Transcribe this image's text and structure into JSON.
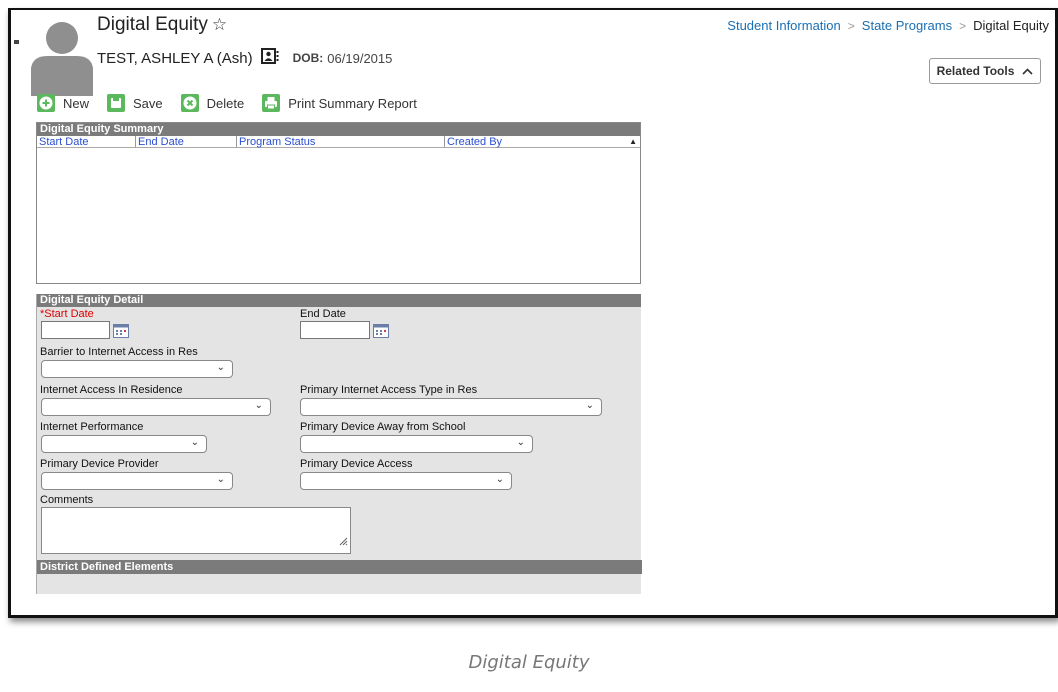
{
  "header": {
    "title": "Digital Equity",
    "student_name": "TEST, ASHLEY A (Ash)",
    "dob_label": "DOB:",
    "dob_value": "06/19/2015",
    "related_tools_label": "Related Tools"
  },
  "breadcrumb": {
    "items": [
      "Student Information",
      "State Programs"
    ],
    "current": "Digital Equity"
  },
  "toolbar": {
    "new_label": "New",
    "save_label": "Save",
    "delete_label": "Delete",
    "print_label": "Print Summary Report"
  },
  "summary": {
    "title": "Digital Equity Summary",
    "columns": [
      "Start Date",
      "End Date",
      "Program Status",
      "Created By"
    ],
    "rows": []
  },
  "detail": {
    "title": "Digital Equity Detail",
    "start_date_label": "*Start Date",
    "start_date_value": "",
    "end_date_label": "End Date",
    "end_date_value": "",
    "barrier_label": "Barrier to Internet Access in Res",
    "barrier_value": "",
    "internet_access_label": "Internet Access In Residence",
    "internet_access_value": "",
    "primary_access_type_label": "Primary Internet Access Type in Res",
    "primary_access_type_value": "",
    "internet_performance_label": "Internet Performance",
    "internet_performance_value": "",
    "device_away_label": "Primary Device Away from School",
    "device_away_value": "",
    "device_provider_label": "Primary Device Provider",
    "device_provider_value": "",
    "device_access_label": "Primary Device Access",
    "device_access_value": "",
    "comments_label": "Comments",
    "comments_value": ""
  },
  "district_elements": {
    "title": "District Defined Elements"
  },
  "caption": "Digital Equity",
  "colors": {
    "accent_green": "#5cb85c",
    "link_blue": "#1a6fb3",
    "column_header_blue": "#2a4fd0",
    "panel_header_gray": "#7b7b7b",
    "panel_body_gray": "#e4e4e4",
    "required_red": "#dd0000"
  },
  "icons": [
    "avatar",
    "star-icon",
    "id-card-icon",
    "chevron-up-icon",
    "plus-icon",
    "save-icon",
    "delete-icon",
    "print-icon",
    "sort-arrow-icon",
    "calendar-icon",
    "chevron-down-icon",
    "resize-grip-icon"
  ]
}
